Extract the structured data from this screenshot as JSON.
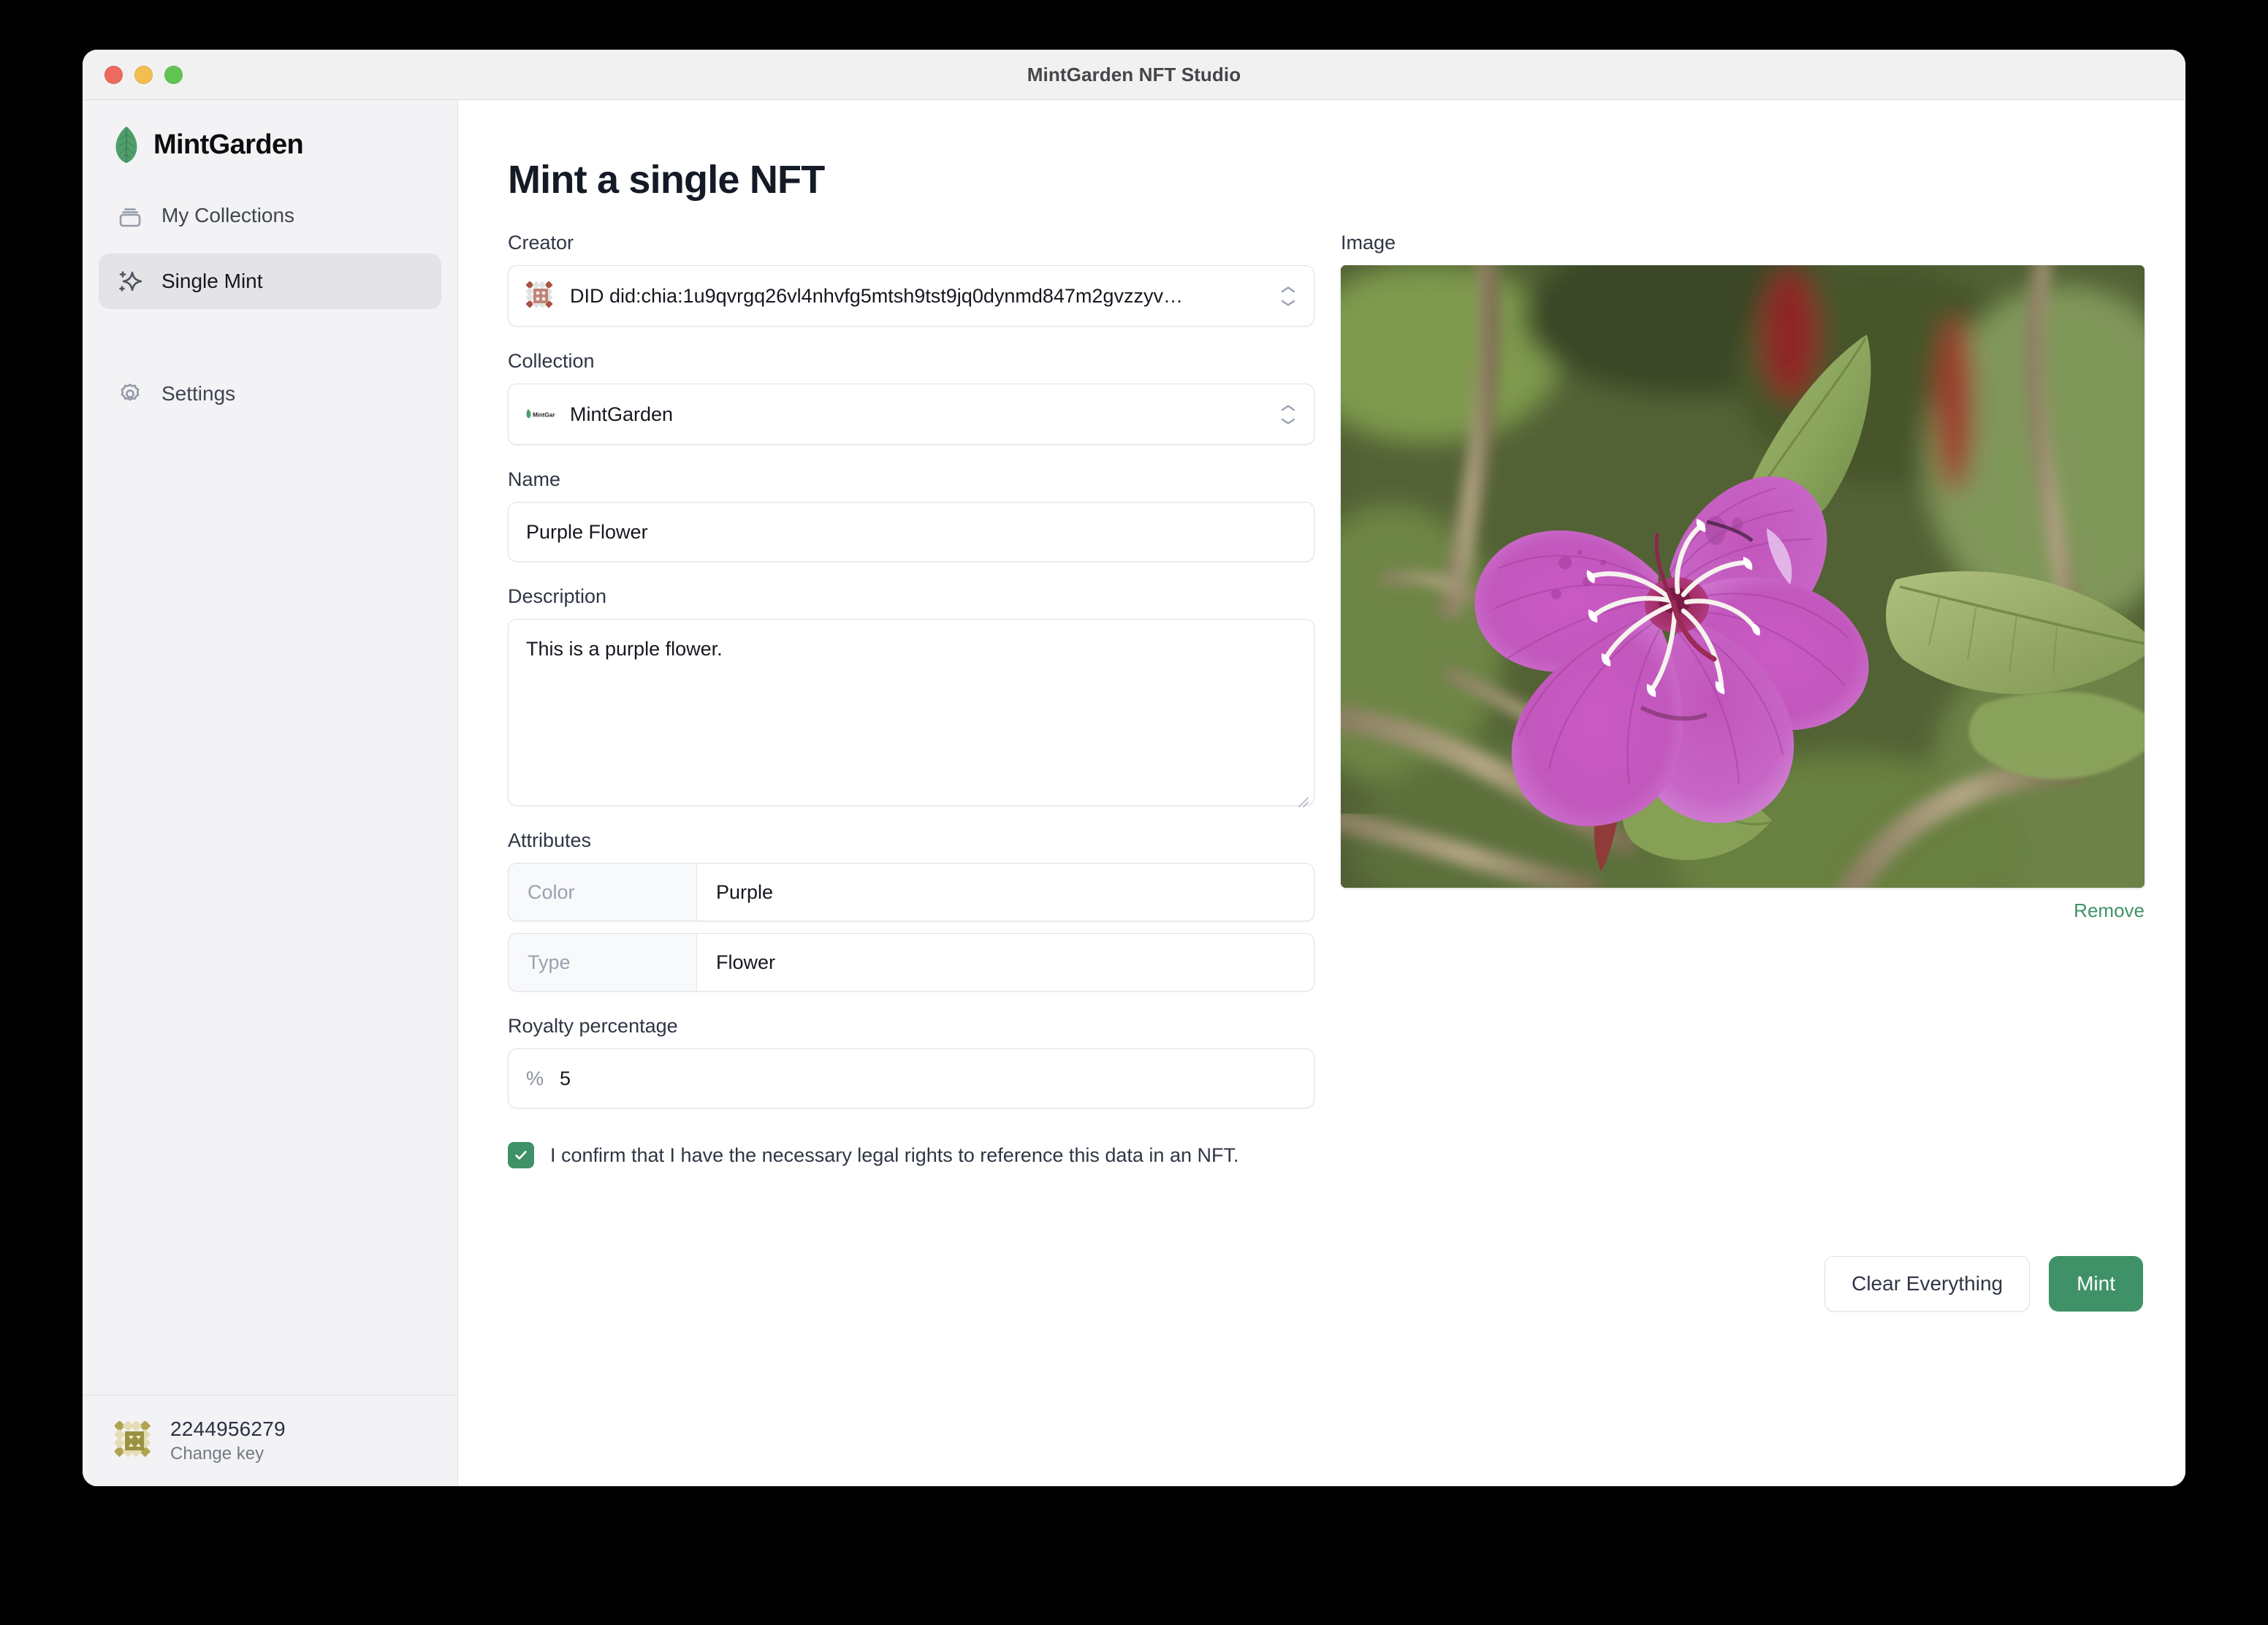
{
  "window": {
    "title": "MintGarden NFT Studio",
    "traffic_lights": [
      "close-red",
      "minimize-yellow",
      "zoom-green"
    ]
  },
  "sidebar": {
    "brand": "MintGarden",
    "items": [
      {
        "label": "My Collections",
        "icon": "collections-icon",
        "active": false
      },
      {
        "label": "Single Mint",
        "icon": "sparkle-icon",
        "active": true
      },
      {
        "label": "Settings",
        "icon": "gear-icon",
        "active": false
      }
    ],
    "footer": {
      "key_id": "2244956279",
      "change_key": "Change key"
    }
  },
  "main": {
    "page_title": "Mint a single NFT",
    "creator": {
      "label": "Creator",
      "value": "DID did:chia:1u9qvrgq26vl4nhvfg5mtsh9tst9jq0dynmd847m2gvzzyv…",
      "icon": "did-identicon"
    },
    "collection": {
      "label": "Collection",
      "value": "MintGarden",
      "icon": "collection-thumb"
    },
    "name": {
      "label": "Name",
      "value": "Purple Flower",
      "placeholder": "Name"
    },
    "description": {
      "label": "Description",
      "value": "This is a purple flower.",
      "placeholder": "Description"
    },
    "attributes": {
      "label": "Attributes",
      "rows": [
        {
          "key": "Color",
          "value": "Purple"
        },
        {
          "key": "Type",
          "value": "Flower"
        }
      ]
    },
    "royalty": {
      "label": "Royalty percentage",
      "prefix": "%",
      "value": "5"
    },
    "confirm": {
      "checked": true,
      "text": "I confirm that I have the necessary legal rights to reference this data in an NFT."
    },
    "actions": {
      "clear_label": "Clear Everything",
      "mint_label": "Mint"
    },
    "image": {
      "label": "Image",
      "remove_label": "Remove",
      "alt": "Purple Tibouchina flower with green leaves"
    }
  },
  "colors": {
    "accent_green": "#3f9268",
    "brand_leaf_green": "#4f9e6b",
    "sidebar_bg": "#f3f3f5",
    "active_item_bg": "#e4e4e7",
    "titlebar_bg": "#f2f1f2",
    "text_primary": "#15181e",
    "text_muted": "#737a86",
    "key_identicon": "#b0a44d"
  }
}
